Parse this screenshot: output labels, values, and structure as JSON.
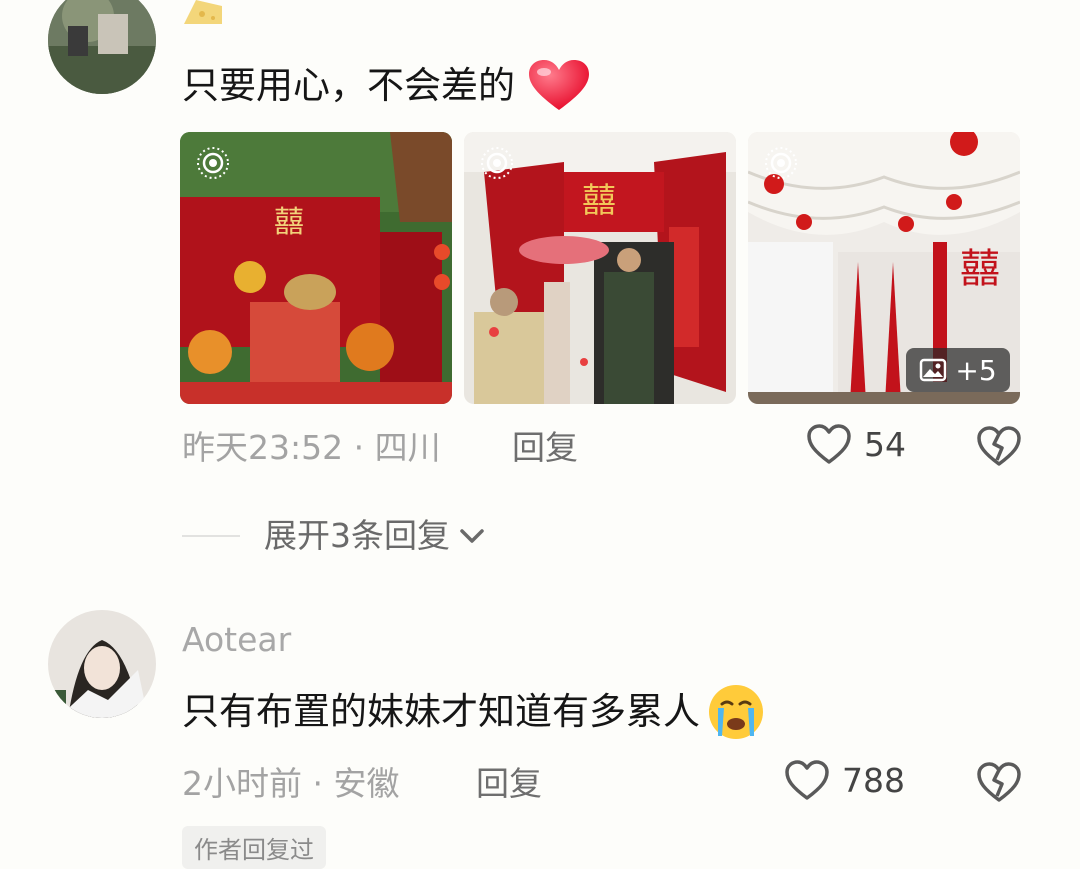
{
  "comment1": {
    "text": "只要用心，不会差的",
    "emoji": "heart-emoji",
    "meta": "昨天23:52 · 四川",
    "reply_label": "回复",
    "likes": "54",
    "images_more": "+5"
  },
  "expand": {
    "label": "展开3条回复"
  },
  "comment2": {
    "username": "Aotear",
    "text": "只有布置的妹妹才知道有多累人",
    "emoji": "crying-face-emoji",
    "meta": "2小时前 · 安徽",
    "reply_label": "回复",
    "likes": "788",
    "author_tag": "作者回复过"
  },
  "colors": {
    "accent_red": "#c7141d",
    "like_icon": "#5a5a5a",
    "heart_emoji": "#ff3355"
  },
  "icons": [
    "live-photo-icon",
    "heart-outline-icon",
    "broken-heart-icon",
    "chevron-down-icon",
    "gallery-icon"
  ]
}
